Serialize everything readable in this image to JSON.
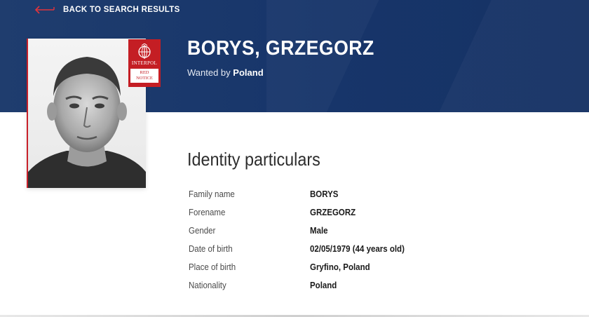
{
  "nav": {
    "back_label": "BACK TO SEARCH RESULTS"
  },
  "header": {
    "name": "BORYS, GRZEGORZ",
    "wanted_prefix": "Wanted by",
    "wanted_country": "Poland"
  },
  "badge": {
    "org": "INTERPOL",
    "notice_line1": "RED",
    "notice_line2": "NOTICE"
  },
  "section": {
    "title": "Identity particulars"
  },
  "particulars": [
    {
      "label": "Family name",
      "value": "BORYS"
    },
    {
      "label": "Forename",
      "value": "GRZEGORZ"
    },
    {
      "label": "Gender",
      "value": "Male"
    },
    {
      "label": "Date of birth",
      "value": "02/05/1979 (44 years old)"
    },
    {
      "label": "Place of birth",
      "value": "Gryfino, Poland"
    },
    {
      "label": "Nationality",
      "value": "Poland"
    }
  ],
  "colors": {
    "banner": "#1a3a6c",
    "accent_red": "#c41e24"
  },
  "icons": {
    "back": "arrow-left-icon",
    "badge_logo": "interpol-globe-icon"
  }
}
